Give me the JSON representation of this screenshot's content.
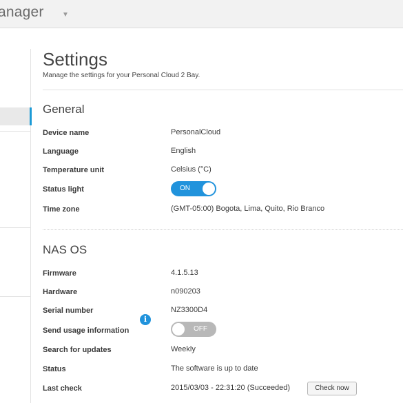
{
  "header": {
    "app_title": "anager",
    "caret": "▼"
  },
  "page": {
    "title": "Settings",
    "subtitle": "Manage the settings for your Personal Cloud 2 Bay."
  },
  "general": {
    "title": "General",
    "rows": {
      "device_name": {
        "label": "Device name",
        "value": "PersonalCloud"
      },
      "language": {
        "label": "Language",
        "value": "English"
      },
      "temperature_unit": {
        "label": "Temperature unit",
        "value": "Celsius (°C)"
      },
      "status_light": {
        "label": "Status light",
        "toggle_text": "ON",
        "state": "on"
      },
      "time_zone": {
        "label": "Time zone",
        "value": "(GMT-05:00) Bogota, Lima, Quito, Rio Branco"
      }
    }
  },
  "nas_os": {
    "title": "NAS OS",
    "rows": {
      "firmware": {
        "label": "Firmware",
        "value": "4.1.5.13"
      },
      "hardware": {
        "label": "Hardware",
        "value": "n090203"
      },
      "serial_number": {
        "label": "Serial number",
        "value": "NZ3300D4"
      },
      "send_usage": {
        "label": "Send usage information",
        "toggle_text": "OFF",
        "state": "off",
        "info_icon": "i"
      },
      "search_updates": {
        "label": "Search for updates",
        "value": "Weekly"
      },
      "status": {
        "label": "Status",
        "value": "The software is up to date"
      },
      "last_check": {
        "label": "Last check",
        "value": "2015/03/03 - 22:31:20 (Succeeded)",
        "button": "Check now"
      }
    }
  },
  "colors": {
    "accent": "#2193dc",
    "toggle_off": "#b8b8b8"
  }
}
